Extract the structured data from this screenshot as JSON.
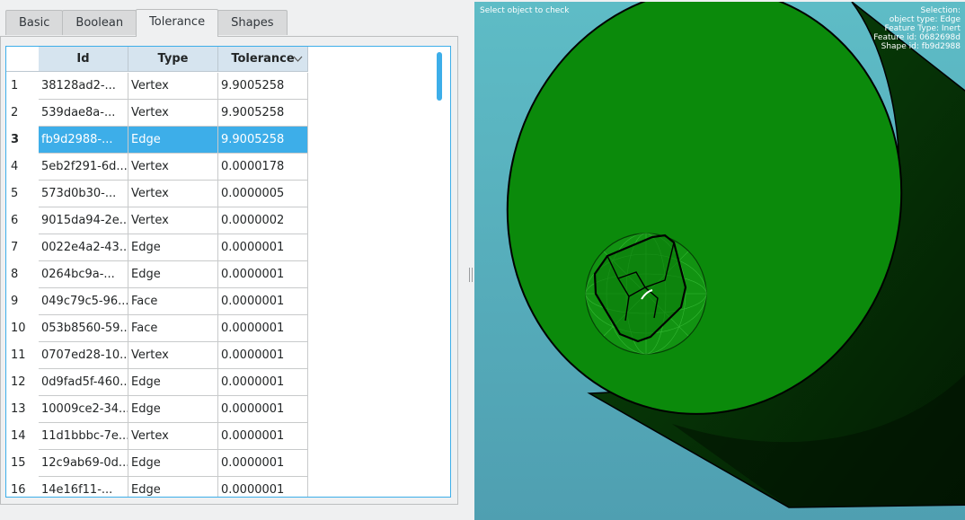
{
  "tabs": [
    {
      "label": "Basic",
      "active": false
    },
    {
      "label": "Boolean",
      "active": false
    },
    {
      "label": "Tolerance",
      "active": true
    },
    {
      "label": "Shapes",
      "active": false
    }
  ],
  "table": {
    "headers": {
      "id": "Id",
      "type": "Type",
      "tolerance": "Tolerance"
    },
    "sort_indicator": "chevron-down-icon",
    "rows": [
      {
        "num": "1",
        "id": "38128ad2-...",
        "type": "Vertex",
        "tolerance": "9.9005258"
      },
      {
        "num": "2",
        "id": "539dae8a-...",
        "type": "Vertex",
        "tolerance": "9.9005258"
      },
      {
        "num": "3",
        "id": "fb9d2988-...",
        "type": "Edge",
        "tolerance": "9.9005258",
        "selected": true
      },
      {
        "num": "4",
        "id": "5eb2f291-6d...",
        "type": "Vertex",
        "tolerance": "0.0000178"
      },
      {
        "num": "5",
        "id": "573d0b30-...",
        "type": "Vertex",
        "tolerance": "0.0000005"
      },
      {
        "num": "6",
        "id": "9015da94-2e...",
        "type": "Vertex",
        "tolerance": "0.0000002"
      },
      {
        "num": "7",
        "id": "0022e4a2-43...",
        "type": "Edge",
        "tolerance": "0.0000001"
      },
      {
        "num": "8",
        "id": "0264bc9a-...",
        "type": "Edge",
        "tolerance": "0.0000001"
      },
      {
        "num": "9",
        "id": "049c79c5-96...",
        "type": "Face",
        "tolerance": "0.0000001"
      },
      {
        "num": "10",
        "id": "053b8560-59...",
        "type": "Face",
        "tolerance": "0.0000001"
      },
      {
        "num": "11",
        "id": "0707ed28-10...",
        "type": "Vertex",
        "tolerance": "0.0000001"
      },
      {
        "num": "12",
        "id": "0d9fad5f-460...",
        "type": "Edge",
        "tolerance": "0.0000001"
      },
      {
        "num": "13",
        "id": "10009ce2-34...",
        "type": "Edge",
        "tolerance": "0.0000001"
      },
      {
        "num": "14",
        "id": "11d1bbbc-7e...",
        "type": "Vertex",
        "tolerance": "0.0000001"
      },
      {
        "num": "15",
        "id": "12c9ab69-0d...",
        "type": "Edge",
        "tolerance": "0.0000001"
      },
      {
        "num": "16",
        "id": "14e16f11-...",
        "type": "Edge",
        "tolerance": "0.0000001"
      }
    ]
  },
  "viewport": {
    "hint": "Select object to check",
    "selection_info": [
      "Selection:",
      "object type: Edge",
      "Feature Type: Inert",
      "Feature id: 0682698d",
      "Shape id: fb9d2988"
    ]
  },
  "colors": {
    "accent": "#3daee9",
    "shape_green": "#0a8a0a",
    "background_teal": "#5ebcc6"
  }
}
